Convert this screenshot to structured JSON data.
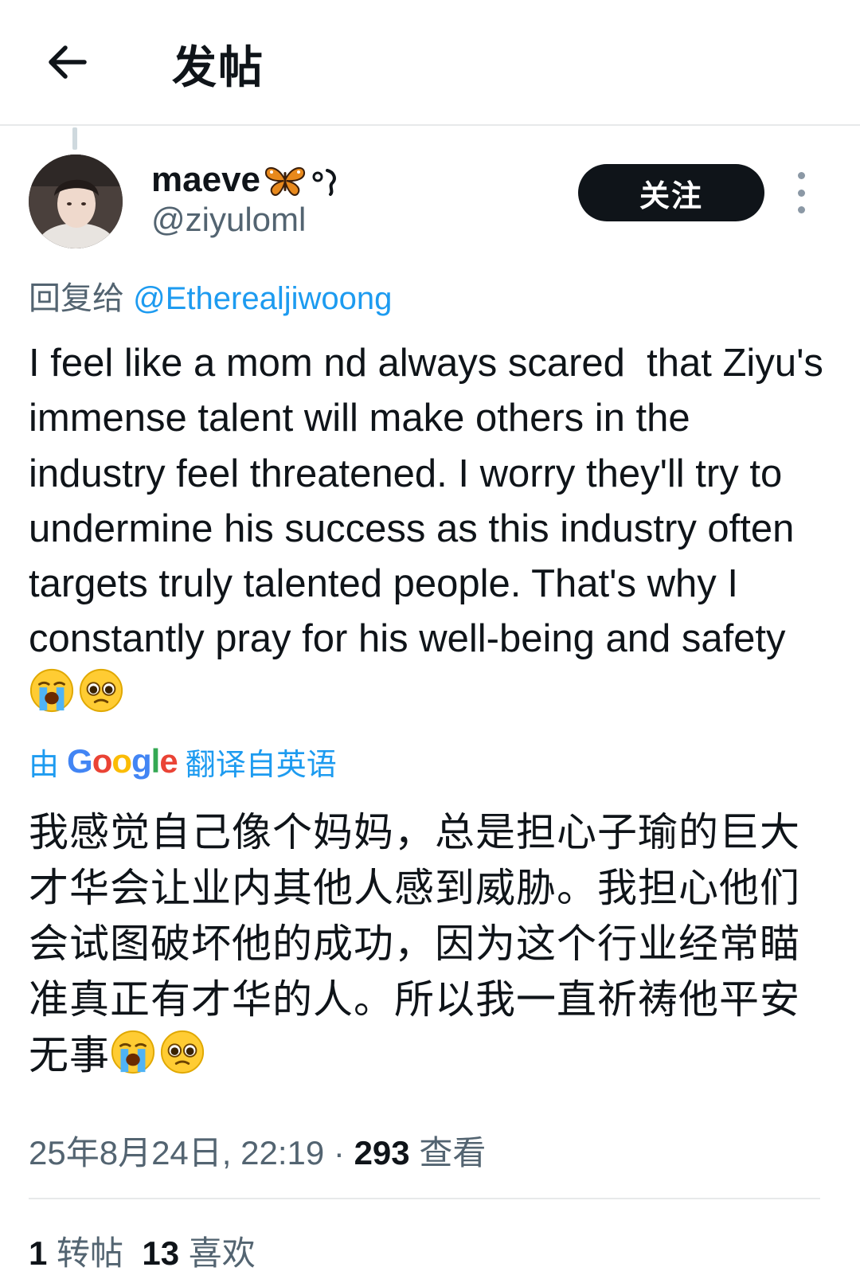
{
  "header": {
    "title": "发帖",
    "back_icon": "arrow-left-icon"
  },
  "author": {
    "display_name": "maeve",
    "display_name_emoji": "butterfly-icon",
    "handle": "@ziyuloml",
    "follow_label": "关注"
  },
  "reply": {
    "prefix": "回复给",
    "target": "@Etherealjiwoong"
  },
  "tweet": {
    "text": "I feel like a mom nd always scared  that Ziyu's immense talent will make others in the industry feel threatened. I worry they'll try to undermine his success as this industry often targets truly talented people. That's why I constantly pray for his well-being and safety",
    "trailing_emojis": [
      "loudly-crying-face-icon",
      "pleading-face-icon"
    ]
  },
  "translation": {
    "prefix": "由",
    "brand": "Google",
    "suffix": "翻译自英语",
    "text": "我感觉自己像个妈妈，总是担心子瑜的巨大才华会让业内其他人感到威胁。我担心他们会试图破坏他的成功，因为这个行业经常瞄准真正有才华的人。所以我一直祈祷他平安无事"
  },
  "meta": {
    "timestamp": "25年8月24日, 22:19",
    "separator": " · ",
    "views_count": "293",
    "views_label": "查看"
  },
  "stats": {
    "reposts_count": "1",
    "reposts_label": "转帖",
    "likes_count": "13",
    "likes_label": "喜欢"
  },
  "colors": {
    "text": "#0f1419",
    "secondary": "#536471",
    "link": "#1d9bf0",
    "button_bg": "#0f1419",
    "divider": "#e7e9ea"
  }
}
